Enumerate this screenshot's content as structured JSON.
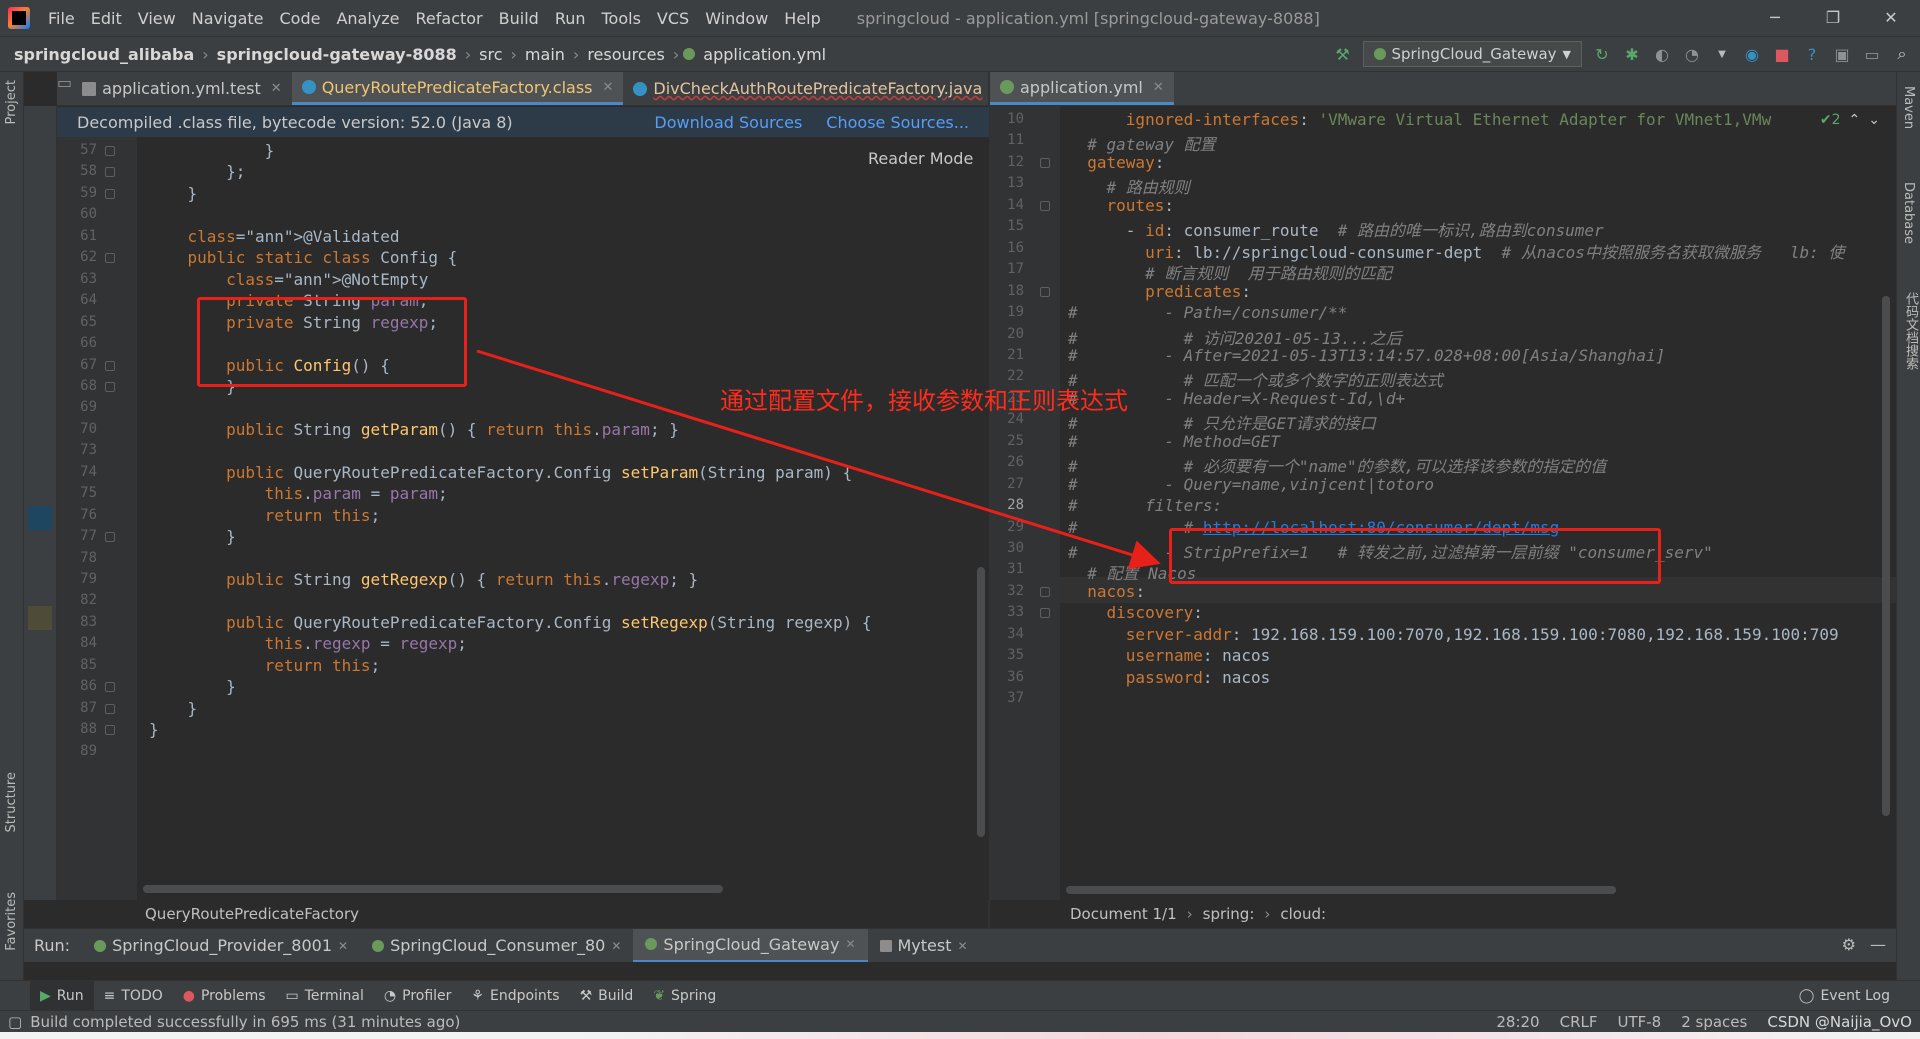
{
  "menubar": {
    "items": [
      "File",
      "Edit",
      "View",
      "Navigate",
      "Code",
      "Analyze",
      "Refactor",
      "Build",
      "Run",
      "Tools",
      "VCS",
      "Window",
      "Help"
    ],
    "title": "springcloud - application.yml [springcloud-gateway-8088]",
    "controls": [
      "─",
      "❐",
      "✕"
    ]
  },
  "navbar": {
    "crumbs": [
      "springcloud_alibaba",
      "springcloud-gateway-8088",
      "src",
      "main",
      "resources",
      "application.yml"
    ],
    "run_config": "SpringCloud_Gateway"
  },
  "left_strip": {
    "project": "Project",
    "structure": "Structure",
    "favorites": "Favorites"
  },
  "right_strip": {
    "maven": "Maven",
    "database": "Database",
    "codeready": "代码文档搜索"
  },
  "left_tabs": [
    {
      "label": "application.yml.test",
      "active": false
    },
    {
      "label": "QueryRoutePredicateFactory.class",
      "active": true
    },
    {
      "label": "DivCheckAuthRoutePredicateFactory.java",
      "active": false
    }
  ],
  "right_tabs": [
    {
      "label": "application.yml",
      "active": true
    }
  ],
  "banner": {
    "text": "Decompiled .class file, bytecode version: 52.0 (Java 8)",
    "download": "Download Sources",
    "choose": "Choose Sources..."
  },
  "reader_mode": "Reader Mode",
  "java_editor": {
    "lines": [
      {
        "n": "57",
        "t": "            }"
      },
      {
        "n": "58",
        "t": "        };"
      },
      {
        "n": "59",
        "t": "    }"
      },
      {
        "n": "60",
        "t": ""
      },
      {
        "n": "61",
        "t": "    @Validated"
      },
      {
        "n": "62",
        "t": "    public static class Config {"
      },
      {
        "n": "63",
        "t": "        @NotEmpty"
      },
      {
        "n": "64",
        "t": "        private String param;"
      },
      {
        "n": "65",
        "t": "        private String regexp;"
      },
      {
        "n": "66",
        "t": ""
      },
      {
        "n": "67",
        "t": "        public Config() {"
      },
      {
        "n": "68",
        "t": "        }"
      },
      {
        "n": "69",
        "t": ""
      },
      {
        "n": "70",
        "t": "        public String getParam() { return this.param; }"
      },
      {
        "n": "73",
        "t": ""
      },
      {
        "n": "74",
        "t": "        public QueryRoutePredicateFactory.Config setParam(String param) {"
      },
      {
        "n": "75",
        "t": "            this.param = param;"
      },
      {
        "n": "76",
        "t": "            return this;"
      },
      {
        "n": "77",
        "t": "        }"
      },
      {
        "n": "78",
        "t": ""
      },
      {
        "n": "79",
        "t": "        public String getRegexp() { return this.regexp; }"
      },
      {
        "n": "82",
        "t": ""
      },
      {
        "n": "83",
        "t": "        public QueryRoutePredicateFactory.Config setRegexp(String regexp) {"
      },
      {
        "n": "84",
        "t": "            this.regexp = regexp;"
      },
      {
        "n": "85",
        "t": "            return this;"
      },
      {
        "n": "86",
        "t": "        }"
      },
      {
        "n": "87",
        "t": "    }"
      },
      {
        "n": "88",
        "t": "}"
      },
      {
        "n": "89",
        "t": ""
      }
    ],
    "crumb": "QueryRoutePredicateFactory"
  },
  "yaml_editor": {
    "lines": [
      {
        "n": "10",
        "t": "      ignored-interfaces: 'VMware Virtual Ethernet Adapter for VMnet1,VMw"
      },
      {
        "n": "11",
        "t": "  # gateway 配置"
      },
      {
        "n": "12",
        "t": "  gateway:"
      },
      {
        "n": "13",
        "t": "    # 路由规则"
      },
      {
        "n": "14",
        "t": "    routes:"
      },
      {
        "n": "15",
        "t": "      - id: consumer_route  # 路由的唯一标识,路由到consumer"
      },
      {
        "n": "16",
        "t": "        uri: lb://springcloud-consumer-dept  # 从nacos中按照服务名获取微服务   lb: 使"
      },
      {
        "n": "17",
        "t": "        # 断言规则  用于路由规则的匹配"
      },
      {
        "n": "18",
        "t": "        predicates:"
      },
      {
        "n": "19",
        "t": "#         - Path=/consumer/**"
      },
      {
        "n": "20",
        "t": "#           # 访问20201-05-13...之后"
      },
      {
        "n": "21",
        "t": "#         - After=2021-05-13T13:14:57.028+08:00[Asia/Shanghai]"
      },
      {
        "n": "22",
        "t": "#           # 匹配一个或多个数字的正则表达式"
      },
      {
        "n": "23",
        "t": "#         - Header=X-Request-Id,\\d+"
      },
      {
        "n": "24",
        "t": "#           # 只允许是GET请求的接口"
      },
      {
        "n": "25",
        "t": "#         - Method=GET"
      },
      {
        "n": "26",
        "t": "#           # 必须要有一个\"name\"的参数,可以选择该参数的指定的值"
      },
      {
        "n": "27",
        "t": "#         - Query=name,vinjcent|totoro"
      },
      {
        "n": "28",
        "t": "#       filters:"
      },
      {
        "n": "29",
        "t": "#           # http://localhost:80/consumer/dept/msg"
      },
      {
        "n": "30",
        "t": "#         - StripPrefix=1   # 转发之前,过滤掉第一层前缀 \"consumer_serv\""
      },
      {
        "n": "31",
        "t": "  # 配置 Nacos"
      },
      {
        "n": "32",
        "t": "  nacos:"
      },
      {
        "n": "33",
        "t": "    discovery:"
      },
      {
        "n": "34",
        "t": "      server-addr: 192.168.159.100:7070,192.168.159.100:7080,192.168.159.100:709"
      },
      {
        "n": "35",
        "t": "      username: nacos"
      },
      {
        "n": "36",
        "t": "      password: nacos"
      },
      {
        "n": "37",
        "t": ""
      }
    ],
    "crumb_doc": "Document 1/1",
    "crumb_spring": "spring:",
    "crumb_cloud": "cloud:",
    "inspection": "✔2"
  },
  "annotation": {
    "text": "通过配置文件，接收参数和正则表达式"
  },
  "run_bar": {
    "label": "Run:",
    "tabs": [
      "SpringCloud_Provider_8001",
      "SpringCloud_Consumer_80",
      "SpringCloud_Gateway",
      "Mytest"
    ]
  },
  "tool_buttons": [
    "Run",
    "TODO",
    "Problems",
    "Terminal",
    "Profiler",
    "Endpoints",
    "Build",
    "Spring"
  ],
  "event_log": "Event Log",
  "status": {
    "message": "Build completed successfully in 695 ms (31 minutes ago)",
    "position": "28:20",
    "line_sep": "CRLF",
    "encoding": "UTF-8",
    "indent": "2 spaces",
    "watermark": "CSDN @Naijia_OvO"
  },
  "colors": {
    "accent": "#4a88c7",
    "annotation_red": "#e8201a",
    "banner_bg": "#2d3b48"
  }
}
